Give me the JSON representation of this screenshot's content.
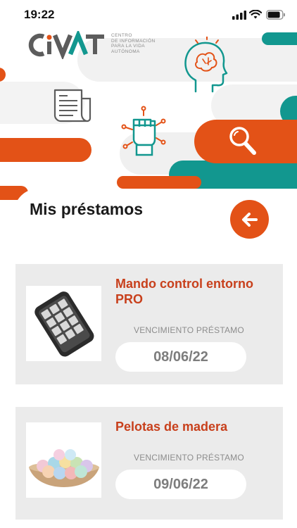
{
  "status_bar": {
    "time": "19:22"
  },
  "logo": {
    "brand": "CIVAT",
    "subtitle_lines": [
      "CENTRO",
      "DE INFORMACIÓN",
      "PARA LA VIDA",
      "AUTÓNOMA"
    ]
  },
  "colors": {
    "accent_orange": "#e35217",
    "accent_teal": "#12978f",
    "card_bg": "#ebebeb",
    "item_title": "#c8401c"
  },
  "page": {
    "title": "Mis préstamos",
    "back_icon": "arrow-left-icon"
  },
  "loans": [
    {
      "name": "Mando control entorno PRO",
      "due_label": "VENCIMIENTO PRÉSTAMO",
      "due_date": "08/06/22"
    },
    {
      "name": "Pelotas de madera",
      "due_label": "VENCIMIENTO PRÉSTAMO",
      "due_date": "09/06/22"
    }
  ]
}
